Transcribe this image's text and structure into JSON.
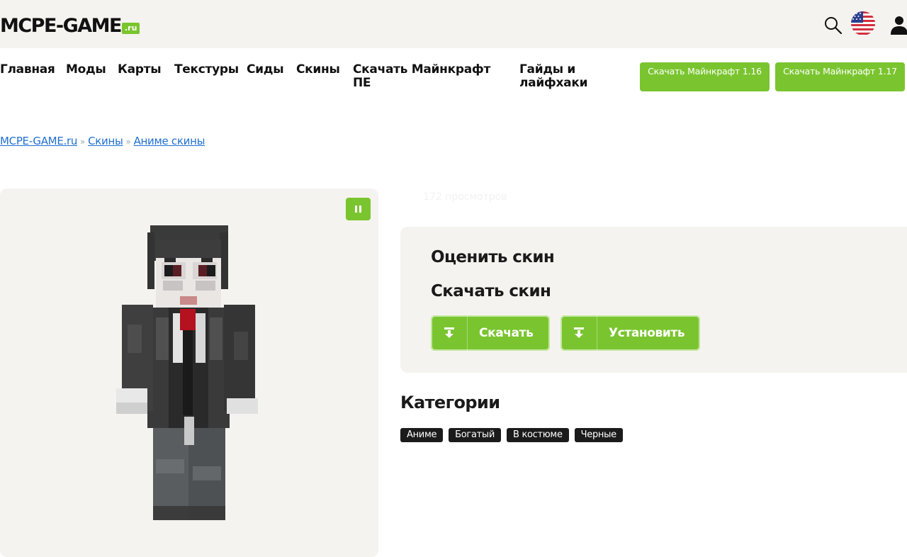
{
  "header": {
    "logo_main": "MCPE-GAME",
    "logo_suffix": ".ru",
    "icons": [
      "search-icon",
      "us-flag-icon",
      "user-icon"
    ]
  },
  "nav": {
    "items": [
      "Главная",
      "Моды",
      "Карты",
      "Текстуры",
      "Сиды",
      "Скины",
      "Скачать Майнкрафт ПЕ",
      "Гайды и лайфхаки"
    ],
    "download_buttons": [
      "Скачать Майнкрафт 1.16",
      "Скачать Майнкрафт 1.17"
    ]
  },
  "breadcrumb": {
    "items": [
      "MCPE-GAME.ru",
      "Скины",
      "Аниме скины"
    ],
    "separator": "»"
  },
  "preview": {
    "views": "172 просмотров"
  },
  "rating": {
    "rate_title": "Оценить скин",
    "download_title": "Скачать скин",
    "download_label": "Скачать",
    "install_label": "Установить"
  },
  "categories": {
    "title": "Категории",
    "tags": [
      "Аниме",
      "Богатый",
      "В костюме",
      "Черные"
    ]
  },
  "colors": {
    "accent": "#7ac52f",
    "panel": "#f5f3ef",
    "link": "#1f6fd1",
    "tag": "#1b1b1b"
  }
}
